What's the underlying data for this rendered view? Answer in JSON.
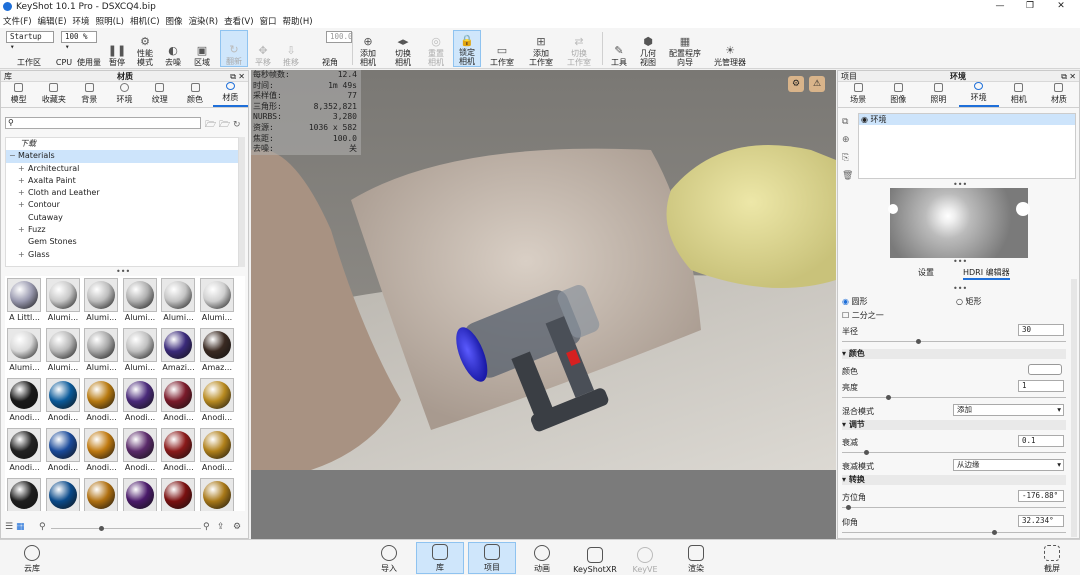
{
  "window": {
    "title": "KeyShot 10.1 Pro - DSXCQ4.bip",
    "min": "—",
    "max": "❐",
    "close": "✕"
  },
  "menu": [
    "文件(F)",
    "编辑(E)",
    "环境",
    "照明(L)",
    "相机(C)",
    "图像",
    "渲染(R)",
    "查看(V)",
    "窗口",
    "帮助(H)"
  ],
  "toolbar": {
    "preset": "Startup",
    "zoom": "100 %",
    "workspace": "工作区",
    "cpu": "CPU",
    "usage": "使用量",
    "pause": "暂停",
    "perf": "性能\n模式",
    "denoise": "去噪",
    "region": "区域",
    "refresh": "翻新",
    "pan": "平移",
    "push": "推移",
    "fov_value": "100.0",
    "view": "视角",
    "add_camera": "添加\n相机",
    "switch_camera": "切换\n相机",
    "reset_camera": "重置\n相机",
    "lock_camera": "锁定\n相机",
    "studio": "工作室",
    "add_studio": "添加\n工作室",
    "switch_studio": "切换\n工作室",
    "tools": "工具",
    "geom_view": "几何\n视图",
    "config_wizard": "配置程序\n向导",
    "light_manager": "光管理器"
  },
  "library": {
    "panel_title": "库",
    "header": "材质",
    "tabs": [
      "模型",
      "收藏夹",
      "背景",
      "环境",
      "纹理",
      "颜色",
      "材质"
    ],
    "search_placeholder": "",
    "tree": [
      "下载",
      "Materials",
      "Architectural",
      "Axalta Paint",
      "Cloth and Leather",
      "Contour",
      "Cutaway",
      "Fuzz",
      "Gem Stones",
      "Glass"
    ],
    "materials": [
      {
        "name": "A Littl...",
        "color": "#9a9ab0"
      },
      {
        "name": "Alumi...",
        "color": "#c8c8c8"
      },
      {
        "name": "Alumi...",
        "color": "#bdbdbd"
      },
      {
        "name": "Alumi...",
        "color": "#b0b0b0"
      },
      {
        "name": "Alumi...",
        "color": "#c4c4c4"
      },
      {
        "name": "Alumi...",
        "color": "#cfcfcf"
      },
      {
        "name": "Alumi...",
        "color": "#d8d8d8"
      },
      {
        "name": "Alumi...",
        "color": "#b8b8b8"
      },
      {
        "name": "Alumi...",
        "color": "#a8a8a8"
      },
      {
        "name": "Alumi...",
        "color": "#c0c0c0"
      },
      {
        "name": "Amazi...",
        "color": "#3a2a7a"
      },
      {
        "name": "Amaz...",
        "color": "#3a2a22"
      },
      {
        "name": "Anodi...",
        "color": "#1a1a1a"
      },
      {
        "name": "Anodi...",
        "color": "#0a5a9a"
      },
      {
        "name": "Anodi...",
        "color": "#b87a10"
      },
      {
        "name": "Anodi...",
        "color": "#4a2a7a"
      },
      {
        "name": "Anodi...",
        "color": "#7a1a2a"
      },
      {
        "name": "Anodi...",
        "color": "#b88a20"
      },
      {
        "name": "Anodi...",
        "color": "#222222"
      },
      {
        "name": "Anodi...",
        "color": "#1a4a9a"
      },
      {
        "name": "Anodi...",
        "color": "#c07a10"
      },
      {
        "name": "Anodi...",
        "color": "#5a2a6a"
      },
      {
        "name": "Anodi...",
        "color": "#8a1a1a"
      },
      {
        "name": "Anodi...",
        "color": "#b0801a"
      },
      {
        "name": "",
        "color": "#1e1e1e"
      },
      {
        "name": "",
        "color": "#0a4a8a"
      },
      {
        "name": "",
        "color": "#b07010"
      },
      {
        "name": "",
        "color": "#4a1a6a"
      },
      {
        "name": "",
        "color": "#7a1010"
      },
      {
        "name": "",
        "color": "#a87818"
      }
    ]
  },
  "stats": [
    [
      "每秒帧数:",
      "12.4"
    ],
    [
      "时间:",
      "1m 49s"
    ],
    [
      "采样值:",
      "77"
    ],
    [
      "三角形:",
      "8,352,821"
    ],
    [
      "NURBS:",
      "3,280"
    ],
    [
      "资源:",
      "1036 x 582"
    ],
    [
      "焦距:",
      "100.0"
    ],
    [
      "去噪:",
      "关"
    ]
  ],
  "project": {
    "panel_title": "项目",
    "header": "环境",
    "tabs": [
      "场景",
      "图像",
      "照明",
      "环境",
      "相机",
      "材质"
    ],
    "env_item": "环境",
    "subtabs": [
      "设置",
      "HDRI 编辑器"
    ],
    "shape_round": "圆形",
    "shape_rect": "矩形",
    "half": "二分之一",
    "radius_label": "半径",
    "radius_value": "30",
    "color_section": "颜色",
    "color_label": "颜色",
    "brightness_label": "亮度",
    "brightness_value": "1",
    "blend_label": "混合模式",
    "blend_value": "添加",
    "adjust_section": "调节",
    "falloff_label": "衰减",
    "falloff_value": "0.1",
    "falloff_mode_label": "衰减模式",
    "falloff_mode_value": "从边缘",
    "transform_section": "转换",
    "azimuth_label": "方位角",
    "azimuth_value": "-176.88°",
    "elevation_label": "仰角",
    "elevation_value": "32.234°"
  },
  "bottom": {
    "cloud": "云库",
    "import": "导入",
    "library": "库",
    "project": "项目",
    "animation": "动画",
    "keyshotxr": "KeyShotXR",
    "keyve": "KeyVE",
    "render": "渲染",
    "screenshot": "截屏"
  }
}
